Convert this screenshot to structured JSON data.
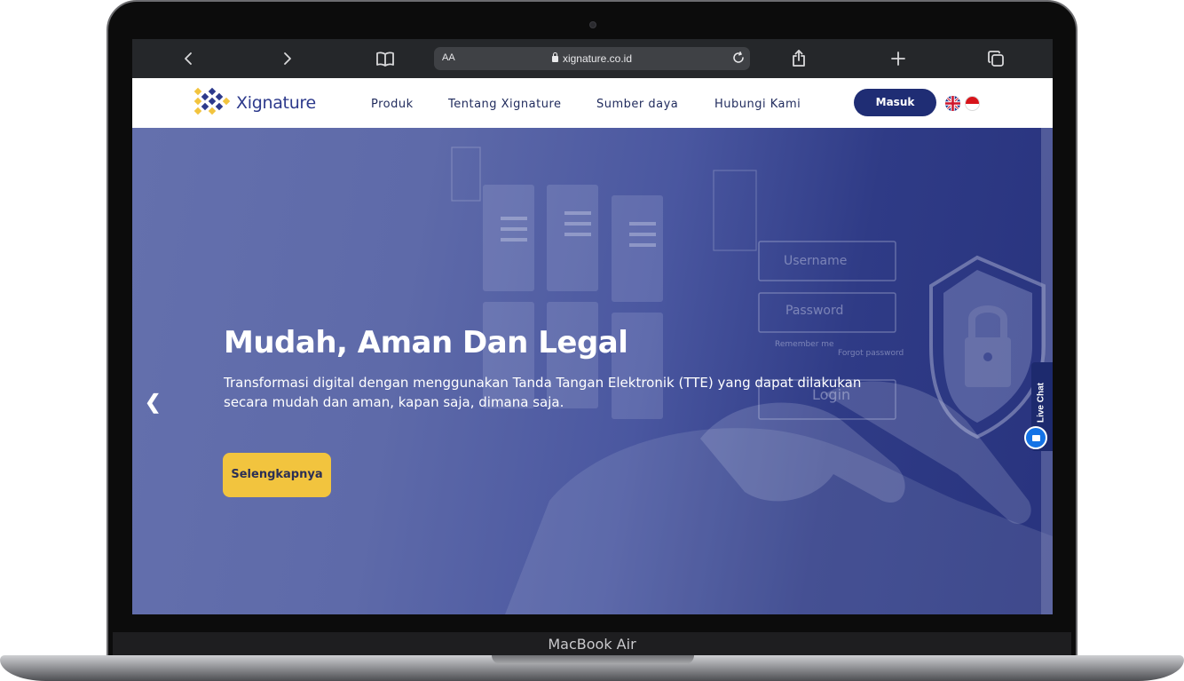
{
  "device": {
    "label": "MacBook Air"
  },
  "browser": {
    "text_size_label": "AA",
    "url": "xignature.co.id",
    "icons": [
      "chevron-left-icon",
      "chevron-right-icon",
      "book-icon",
      "reload-icon",
      "share-icon",
      "plus-icon",
      "tabs-icon"
    ]
  },
  "site": {
    "logo_text": "Xignature",
    "nav": [
      "Produk",
      "Tentang Xignature",
      "Sumber daya",
      "Hubungi Kami"
    ],
    "login_label": "Masuk",
    "languages": [
      "English",
      "Indonesia"
    ]
  },
  "hero": {
    "title": "Mudah, Aman Dan Legal",
    "subtitle": "Transformasi digital dengan menggunakan Tanda Tangan Elektronik (TTE) yang dapat dilakukan secara mudah dan aman, kapan saja, dimana saja.",
    "cta_label": "Selengkapnya",
    "prev_label": "❮",
    "background_labels": {
      "username": "Username",
      "password": "Password",
      "remember": "Remember me",
      "forgot": "Forgot password",
      "login": "Login"
    }
  },
  "live_chat": {
    "label": "Live Chat"
  },
  "colors": {
    "brand_navy": "#1f2d74",
    "brand_yellow": "#f2c43e",
    "hero_overlay": "#4a57a0"
  }
}
